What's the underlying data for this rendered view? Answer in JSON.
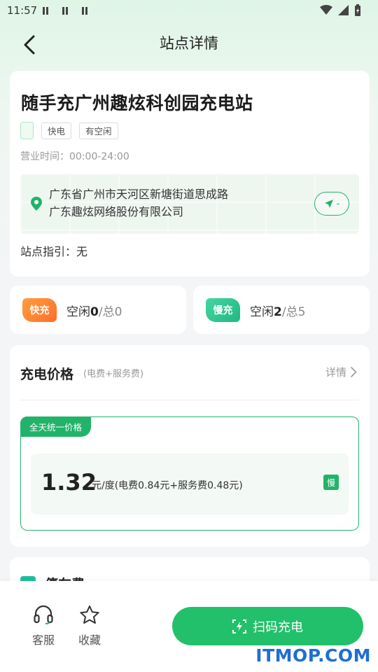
{
  "status_bar": {
    "time": "11:57"
  },
  "header": {
    "title": "站点详情"
  },
  "station": {
    "name": "随手充广州趣炫科创园充电站",
    "tags": [
      "快电",
      "有空闲"
    ],
    "hours": "营业时间：00:00-24:00",
    "address_line1": "广东省广州市天河区新塘街道思成路",
    "address_line2": "广东趣炫网络股份有限公司",
    "nav_distance": "-",
    "guide": "站点指引：无"
  },
  "chargers": {
    "fast": {
      "badge": "快充",
      "free_label": "空闲",
      "free": "0",
      "total_label": "/总",
      "total": "0"
    },
    "slow": {
      "badge": "慢充",
      "free_label": "空闲",
      "free": "2",
      "total_label": "/总",
      "total": "5"
    }
  },
  "price": {
    "title": "充电价格",
    "subtitle": "(电费+服务费)",
    "detail_link": "详情",
    "plan_label": "全天统一价格",
    "value": "1.32",
    "unit_text": "元/度(电费0.84元+服务费0.48元)",
    "type_chip": "慢"
  },
  "parking": {
    "title": "停车费"
  },
  "bottom_bar": {
    "service_label": "客服",
    "favorite_label": "收藏",
    "scan_label": "扫码充电"
  },
  "watermark": "ITMOP.COM",
  "colors": {
    "accent": "#22c06a",
    "fast": "#ff7e2e",
    "slow": "#2fc58f"
  }
}
